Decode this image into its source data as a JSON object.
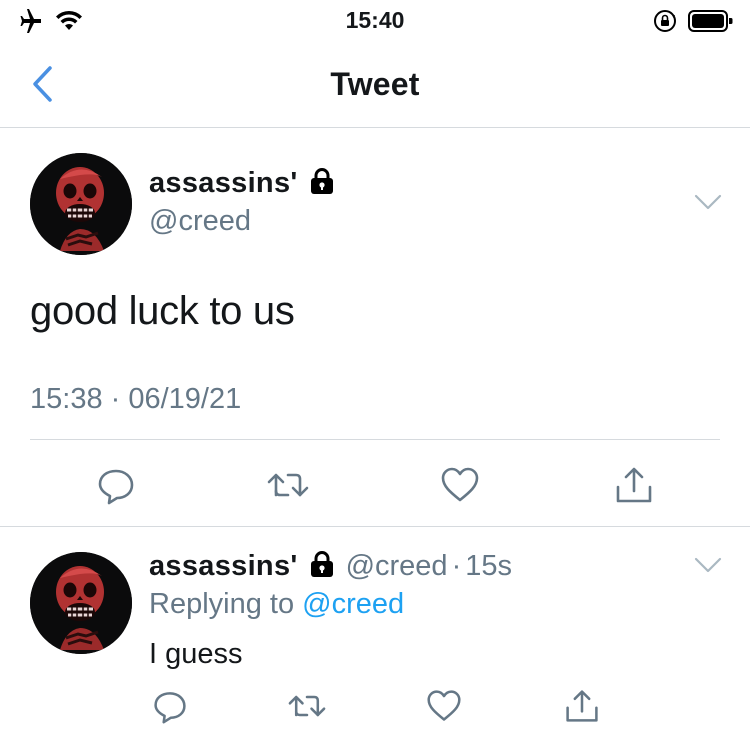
{
  "status_bar": {
    "time": "15:40",
    "left_icons": [
      "airplane-icon",
      "wifi-icon"
    ],
    "right_icons": [
      "orientation-lock-icon",
      "battery-icon"
    ]
  },
  "nav": {
    "title": "Tweet",
    "back_icon": "chevron-left-icon"
  },
  "main_tweet": {
    "display_name": "assassins'",
    "handle": "@creed",
    "locked": true,
    "text": "good luck to us",
    "timestamp": "15:38 · 06/19/21",
    "actions": [
      "reply-icon",
      "retweet-icon",
      "like-icon",
      "share-icon"
    ]
  },
  "reply_tweet": {
    "display_name": "assassins'",
    "handle": "@creed",
    "separator": "·",
    "age": "15s",
    "replying_prefix": "Replying to",
    "replying_to": "@creed",
    "text": "I guess",
    "actions": [
      "reply-icon",
      "retweet-icon",
      "like-icon",
      "share-icon"
    ]
  },
  "colors": {
    "accent": "#1da1f2",
    "back_arrow": "#4a90e2",
    "secondary_text": "#657786",
    "divider": "#d6dade",
    "icon_gray": "#657786"
  }
}
